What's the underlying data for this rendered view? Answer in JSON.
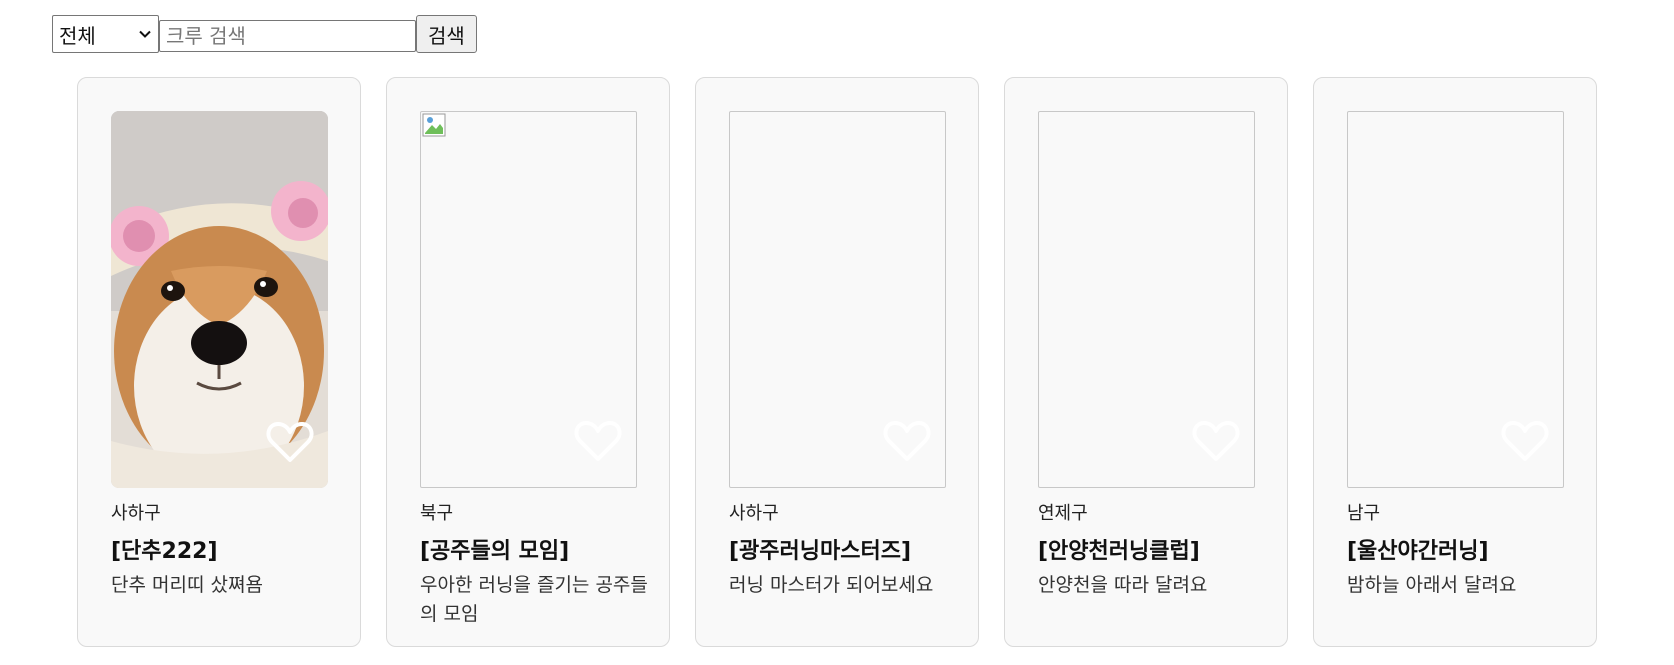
{
  "search": {
    "region_selected": "전체",
    "query_placeholder": "크루 검색",
    "query_value": "",
    "button_label": "검색"
  },
  "crews": [
    {
      "region": "사하구",
      "title": "[단추222]",
      "description": "단추 머리띠 샀쪄욤",
      "image": "shiba-inu-dog-photo",
      "liked": false
    },
    {
      "region": "북구",
      "title": "[공주들의 모임]",
      "description": "우아한 러닝을 즐기는 공주들의 모임",
      "image": "broken-image",
      "liked": false
    },
    {
      "region": "사하구",
      "title": "[광주러닝마스터즈]",
      "description": "러닝 마스터가 되어보세요",
      "image": "none",
      "liked": false
    },
    {
      "region": "연제구",
      "title": "[안양천러닝클럽]",
      "description": "안양천을 따라 달려요",
      "image": "none",
      "liked": false
    },
    {
      "region": "남구",
      "title": "[울산야간러닝]",
      "description": "밤하늘 아래서 달려요",
      "image": "none",
      "liked": false
    }
  ]
}
